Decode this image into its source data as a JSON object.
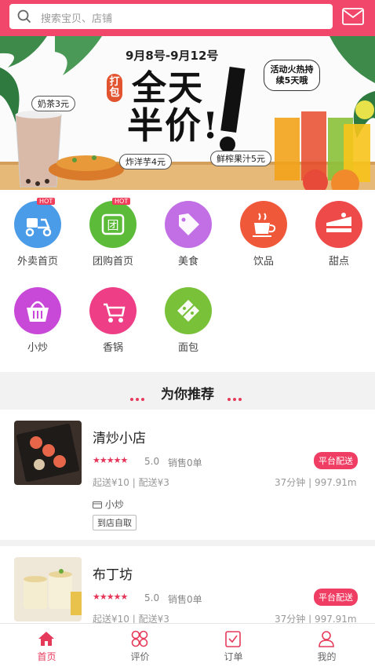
{
  "search": {
    "placeholder": "搜索宝贝、店铺"
  },
  "banner": {
    "date": "9月8号-9月12号",
    "title_line1": "全天",
    "title_line2": "半价!",
    "dabao": "打包",
    "tag_milk_tea": "奶茶3元",
    "tag_fries": "炸洋芋4元",
    "tag_juice": "鲜榨果汁5元",
    "promo": "活动火热持续5天哦"
  },
  "categories": [
    {
      "label": "外卖首页",
      "icon": "scooter-icon",
      "hot": "HOT",
      "color": "#4a9be8"
    },
    {
      "label": "团购首页",
      "icon": "group-buy-icon",
      "hot": "HOT",
      "color": "#5dbb3a"
    },
    {
      "label": "美食",
      "icon": "tag-icon",
      "hot": "",
      "color": "#c26fe6"
    },
    {
      "label": "饮品",
      "icon": "coffee-cup-icon",
      "hot": "",
      "color": "#f0583a"
    },
    {
      "label": "甜点",
      "icon": "cake-icon",
      "hot": "",
      "color": "#ef4a4a"
    },
    {
      "label": "小炒",
      "icon": "basket-icon",
      "hot": "",
      "color": "#c849d8"
    },
    {
      "label": "香锅",
      "icon": "stroller-icon",
      "hot": "",
      "color": "#ee3f86"
    },
    {
      "label": "面包",
      "icon": "price-tag-icon",
      "hot": "",
      "color": "#7ac13a"
    }
  ],
  "section": {
    "title": "为你推荐"
  },
  "shops": [
    {
      "name": "清炒小店",
      "stars": "★★★★★",
      "rating": "5.0",
      "sales": "销售0单",
      "badge": "平台配送",
      "fee": "起送¥10 | 配送¥3",
      "time": "37分钟 | 997.91m",
      "tagline": "小炒",
      "pickup": "到店自取"
    },
    {
      "name": "布丁坊",
      "stars": "★★★★★",
      "rating": "5.0",
      "sales": "销售0单",
      "badge": "平台配送",
      "fee": "起送¥10 | 配送¥3",
      "time": "37分钟 | 997.91m"
    }
  ],
  "nav": [
    {
      "label": "首页",
      "icon": "home-icon",
      "active": true
    },
    {
      "label": "评价",
      "icon": "grid-icon",
      "active": false
    },
    {
      "label": "订单",
      "icon": "order-icon",
      "active": false
    },
    {
      "label": "我的",
      "icon": "user-icon",
      "active": false
    }
  ],
  "colors": {
    "brand": "#f0476a",
    "accent": "#e63a5b"
  }
}
